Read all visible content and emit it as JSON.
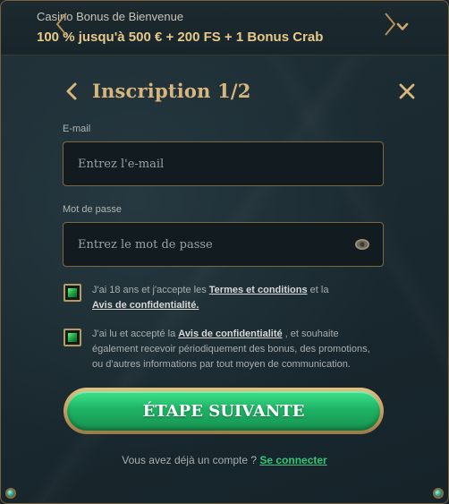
{
  "bonus": {
    "title": "Casino Bonus de Bienvenue",
    "offer": "100 % jusqu'à 500 € + 200 FS + 1 Bonus Crab"
  },
  "header": {
    "title": "Inscription 1/2"
  },
  "form": {
    "email_label": "E-mail",
    "email_placeholder": "Entrez l'e-mail",
    "email_value": "",
    "password_label": "Mot de passe",
    "password_placeholder": "Entrez le mot de passe",
    "password_value": ""
  },
  "consents": [
    {
      "checked": true,
      "text_before": "J'ai 18 ans et j'accepte les ",
      "link1": "Termes et conditions",
      "text_mid": " et la ",
      "link2": "Avis de confidentialité."
    },
    {
      "checked": true,
      "text_before": "J'ai lu et accepté la ",
      "link1": "Avis de confidentialité",
      "text_after": " , et souhaite également recevoir périodiquement des bonus, des promotions, ou d'autres informations par tout moyen de communication."
    }
  ],
  "cta": {
    "label": "ÉTAPE SUIVANTE"
  },
  "footer": {
    "text": "Vous avez déjà un compte ? ",
    "link": "Se connecter"
  },
  "colors": {
    "gold": "#d8b57d",
    "green": "#1fb366",
    "link_green": "#2fc878",
    "background": "#1a262c"
  },
  "icons": {
    "bonus_toggle": "chevron-down-icon",
    "back": "chevron-left-icon",
    "close": "close-icon",
    "password_toggle": "eye-icon",
    "checkbox": "checkbox-checked-icon"
  }
}
